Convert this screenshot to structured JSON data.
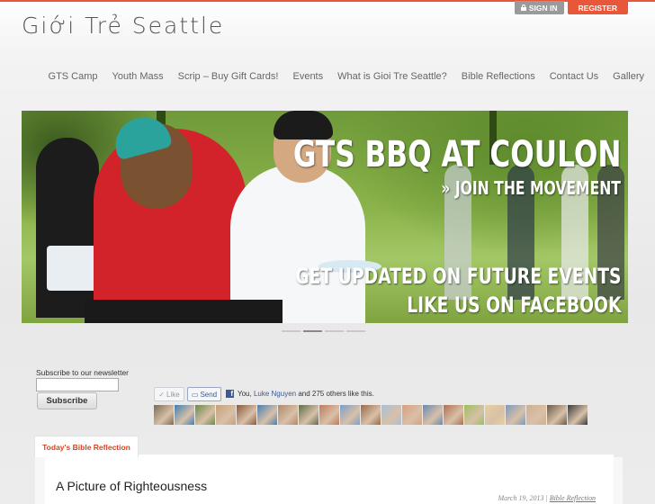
{
  "site": {
    "title": "Giới Trẻ Seattle"
  },
  "auth": {
    "signin_label": "SIGN IN",
    "register_label": "REGISTER"
  },
  "nav": {
    "items": [
      {
        "label": "GTS Camp"
      },
      {
        "label": "Youth Mass"
      },
      {
        "label": "Scrip – Buy Gift Cards!"
      },
      {
        "label": "Events"
      },
      {
        "label": "What is Gioi Tre Seattle?"
      },
      {
        "label": "Bible Reflections"
      },
      {
        "label": "Contact Us"
      },
      {
        "label": "Gallery"
      }
    ]
  },
  "hero": {
    "headline": "GTS BBQ AT COULON",
    "subheadline": "» JOIN THE MOVEMENT",
    "cta_line1": "GET UPDATED ON FUTURE EVENTS",
    "cta_line2": "LIKE US ON FACEBOOK",
    "slides": [
      {
        "active": false
      },
      {
        "active": true
      },
      {
        "active": false
      },
      {
        "active": false
      }
    ]
  },
  "newsletter": {
    "label": "Subscribe to our newsletter",
    "input_value": "",
    "button_label": "Subscribe"
  },
  "facebook": {
    "like_label": "Like",
    "send_label": "Send",
    "social_prefix": "You, ",
    "social_link": "Luke Nguyen",
    "social_suffix": " and 275 others like this.",
    "face_colors": [
      "#7a6a58",
      "#3f7fb5",
      "#6b8a4a",
      "#c9a07a",
      "#8a5a3a",
      "#4a7fb0",
      "#b08a6a",
      "#5e6e4e",
      "#c07a5a",
      "#7aa0c8",
      "#9a6a4a",
      "#a8c0d8",
      "#d8a080",
      "#6a8ab0",
      "#b07050",
      "#9ac060",
      "#e8d0a0",
      "#7a9ac0",
      "#d0b090",
      "#6a5a4a",
      "#3a3a3a",
      "#c86a4a",
      "#8ab0d0",
      "#5a4a3a",
      "#c04040",
      "#e0b0a0",
      "#7a3a2a",
      "#a8a8a8",
      "#d06060",
      "#2a2a2a"
    ]
  },
  "reflection": {
    "tab_label": "Today's Bible Reflection",
    "title": "A Picture of Righteousness",
    "date": "March 19, 2013",
    "separator": "|",
    "category": "Bible Reflection"
  }
}
